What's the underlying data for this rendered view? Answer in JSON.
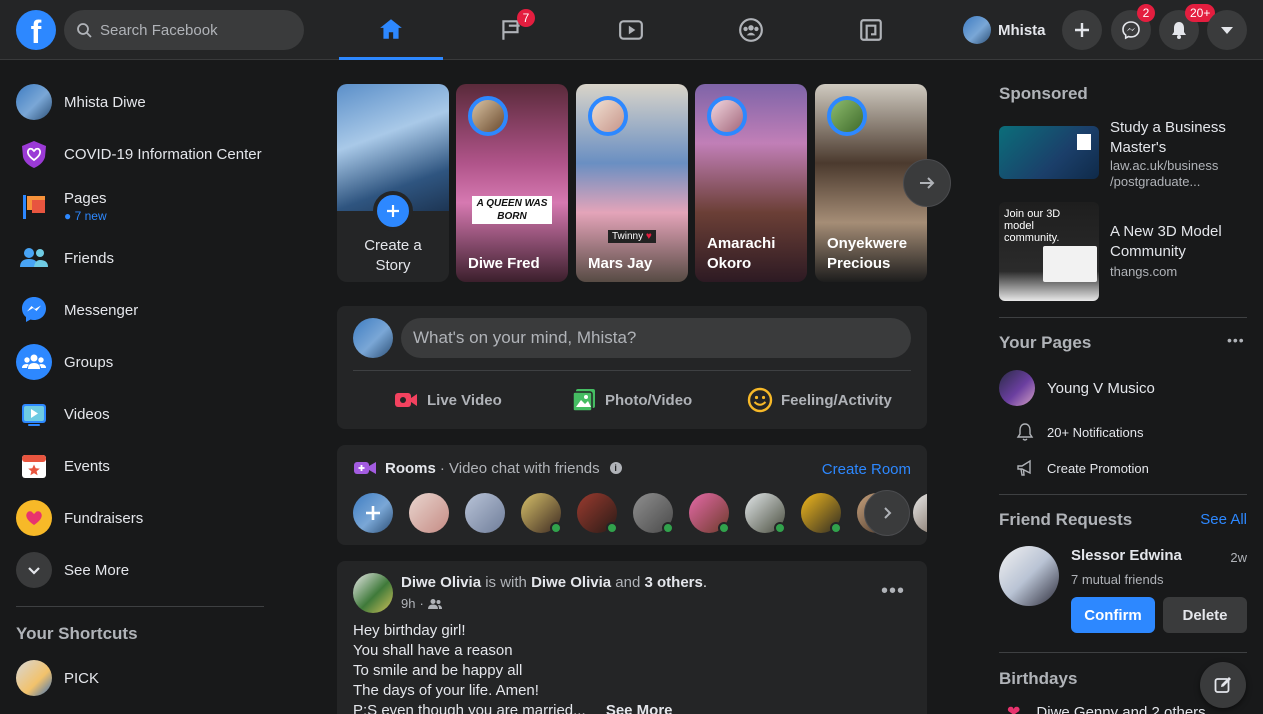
{
  "colors": {
    "accent": "#2d88ff",
    "background": "#18191a",
    "surface": "#242526",
    "badge": "#e41e3f",
    "online": "#31a24c"
  },
  "topbar": {
    "logo_letter": "f",
    "search_placeholder": "Search Facebook",
    "nav_tabs": [
      {
        "icon": "home-icon",
        "active": true
      },
      {
        "icon": "flag-icon",
        "badge": "7"
      },
      {
        "icon": "watch-icon"
      },
      {
        "icon": "groups-icon"
      },
      {
        "icon": "gaming-icon"
      }
    ],
    "profile_name": "Mhista",
    "messenger_badge": "2",
    "notifications_badge": "20+"
  },
  "sidebar": {
    "items": [
      {
        "label": "Mhista Diwe",
        "icon": "profile-avatar"
      },
      {
        "label": "COVID-19 Information Center",
        "icon": "covid-icon"
      },
      {
        "label": "Pages",
        "sub": "7 new",
        "icon": "pages-icon"
      },
      {
        "label": "Friends",
        "icon": "friends-icon"
      },
      {
        "label": "Messenger",
        "icon": "messenger-icon"
      },
      {
        "label": "Groups",
        "icon": "groups-icon"
      },
      {
        "label": "Videos",
        "icon": "videos-icon"
      },
      {
        "label": "Events",
        "icon": "events-icon"
      },
      {
        "label": "Fundraisers",
        "icon": "fundraisers-icon"
      },
      {
        "label": "See More",
        "icon": "chevron-down-icon"
      }
    ],
    "shortcuts_title": "Your Shortcuts",
    "shortcuts": [
      {
        "label": "PICK"
      }
    ]
  },
  "stories": {
    "create_label_line1": "Create a",
    "create_label_line2": "Story",
    "items": [
      {
        "name_line1": "Diwe Fred",
        "name_line2": "",
        "overlay": "A QUEEN WAS BORN"
      },
      {
        "name_line1": "Mars Jay",
        "name_line2": "",
        "overlay": "Twinny"
      },
      {
        "name_line1": "Amarachi",
        "name_line2": "Okoro"
      },
      {
        "name_line1": "Onyekwere",
        "name_line2": "Precious"
      }
    ]
  },
  "composer": {
    "placeholder": "What's on your mind, Mhista?",
    "live": "Live Video",
    "photo": "Photo/Video",
    "feeling": "Feeling/Activity"
  },
  "rooms": {
    "title": "Rooms",
    "subtitle": "· Video chat with friends",
    "create": "Create Room"
  },
  "post": {
    "author": "Diwe Olivia",
    "with_text": "is with",
    "with_name": "Diwe Olivia",
    "and_text": "and",
    "others": "3 others",
    "period": ".",
    "time": "9h",
    "lines": [
      "Hey birthday girl!",
      "You shall have a reason",
      "To smile and be happy all",
      "The days of your life. Amen!",
      "P:S even though you are married..."
    ],
    "see_more": "See More"
  },
  "right": {
    "sponsored_title": "Sponsored",
    "ads": [
      {
        "title": "Study a Business Master's",
        "url_line1": "law.ac.uk/business",
        "url_line2": "/postgraduate..."
      },
      {
        "title": "A New 3D Model Community",
        "url_line1": "thangs.com",
        "url_line2": "",
        "img_text": "Join our 3D model community."
      }
    ],
    "your_pages_title": "Your Pages",
    "page_name": "Young V Musico",
    "notifications": "20+ Notifications",
    "promotion": "Create Promotion",
    "friend_requests_title": "Friend Requests",
    "see_all": "See All",
    "request": {
      "name": "Slessor Edwina",
      "time": "2w",
      "mutual": "7 mutual friends"
    },
    "confirm": "Confirm",
    "delete": "Delete",
    "birthdays_title": "Birthdays",
    "birthday_text": "Diwe Genny and 2 others"
  }
}
